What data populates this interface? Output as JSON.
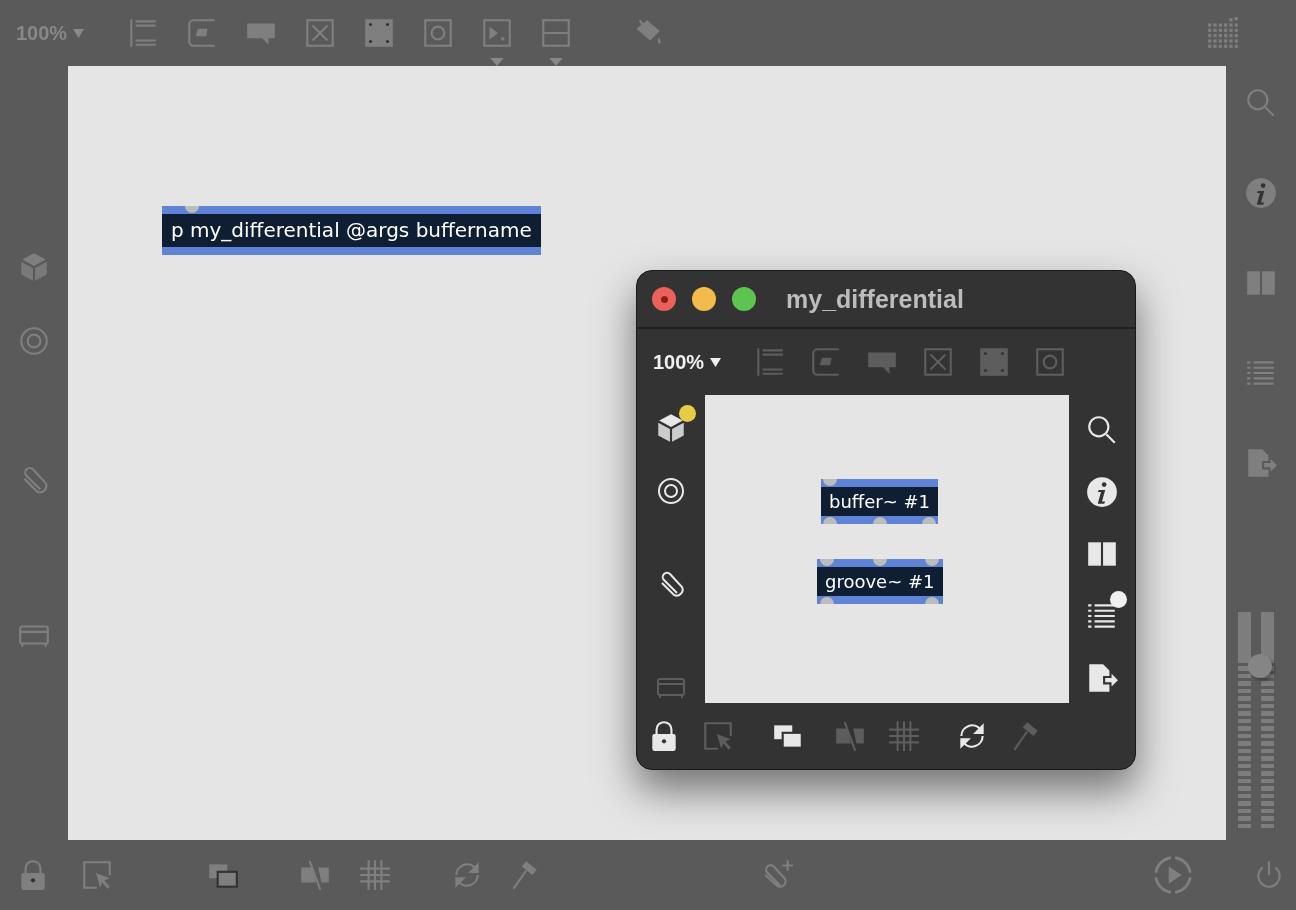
{
  "main": {
    "zoom": "100%",
    "objects": [
      {
        "text": "p my_differential @args buffername"
      }
    ]
  },
  "subwindow": {
    "title": "my_differential",
    "zoom": "100%",
    "objects": [
      {
        "text": "buffer~ #1"
      },
      {
        "text": "groove~ #1"
      }
    ]
  },
  "volume": {
    "level": 0.75
  }
}
